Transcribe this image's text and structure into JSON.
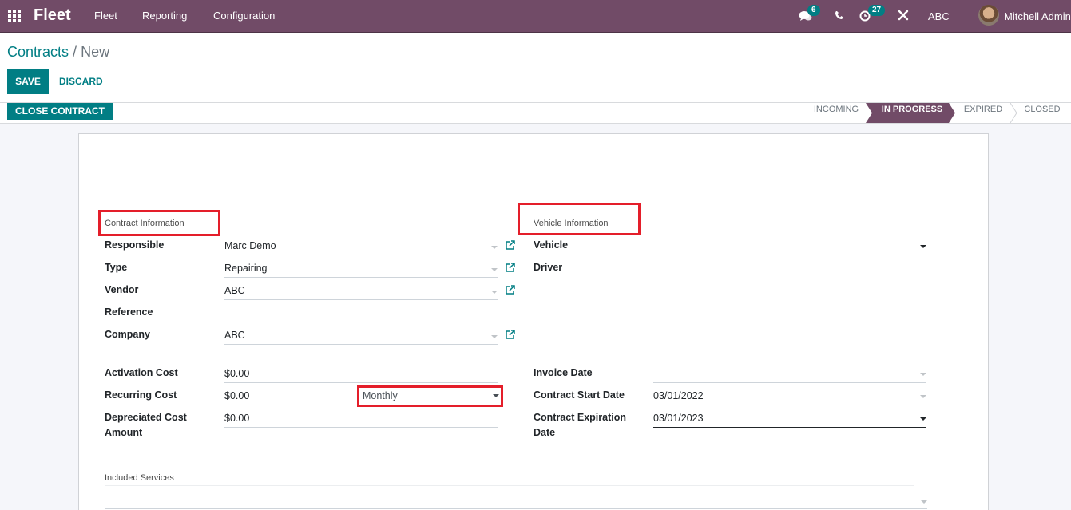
{
  "navbar": {
    "brand": "Fleet",
    "menus": [
      "Fleet",
      "Reporting",
      "Configuration"
    ],
    "messages_count": "6",
    "activities_count": "27",
    "company": "ABC",
    "user": "Mitchell Admin"
  },
  "breadcrumb": {
    "parent": "Contracts",
    "separator": "/",
    "current": "New"
  },
  "buttons": {
    "save": "SAVE",
    "discard": "DISCARD",
    "close_contract": "CLOSE CONTRACT"
  },
  "stages": [
    {
      "label": "INCOMING",
      "active": false
    },
    {
      "label": "IN PROGRESS",
      "active": true
    },
    {
      "label": "EXPIRED",
      "active": false
    },
    {
      "label": "CLOSED",
      "active": false
    }
  ],
  "contract_info": {
    "title": "Contract Information",
    "fields": {
      "responsible": {
        "label": "Responsible",
        "value": "Marc Demo"
      },
      "type": {
        "label": "Type",
        "value": "Repairing"
      },
      "vendor": {
        "label": "Vendor",
        "value": "ABC"
      },
      "reference": {
        "label": "Reference",
        "value": ""
      },
      "company": {
        "label": "Company",
        "value": "ABC"
      }
    }
  },
  "vehicle_info": {
    "title": "Vehicle Information",
    "fields": {
      "vehicle": {
        "label": "Vehicle",
        "value": ""
      },
      "driver": {
        "label": "Driver",
        "value": ""
      }
    }
  },
  "costs": {
    "activation": {
      "label": "Activation Cost",
      "value": "$0.00"
    },
    "recurring": {
      "label": "Recurring Cost",
      "value": "$0.00",
      "frequency": "Monthly"
    },
    "depreciated": {
      "label_line1": "Depreciated Cost",
      "label_line2": "Amount",
      "value": "$0.00"
    }
  },
  "dates": {
    "invoice": {
      "label": "Invoice Date",
      "value": ""
    },
    "start": {
      "label": "Contract Start Date",
      "value": "03/01/2022"
    },
    "expiration": {
      "label_line1": "Contract Expiration",
      "label_line2": "Date",
      "value": "03/01/2023"
    }
  },
  "services": {
    "title": "Included Services"
  },
  "colors": {
    "brand": "#714b67",
    "accent": "#017e84",
    "highlight": "#e41e2a"
  }
}
